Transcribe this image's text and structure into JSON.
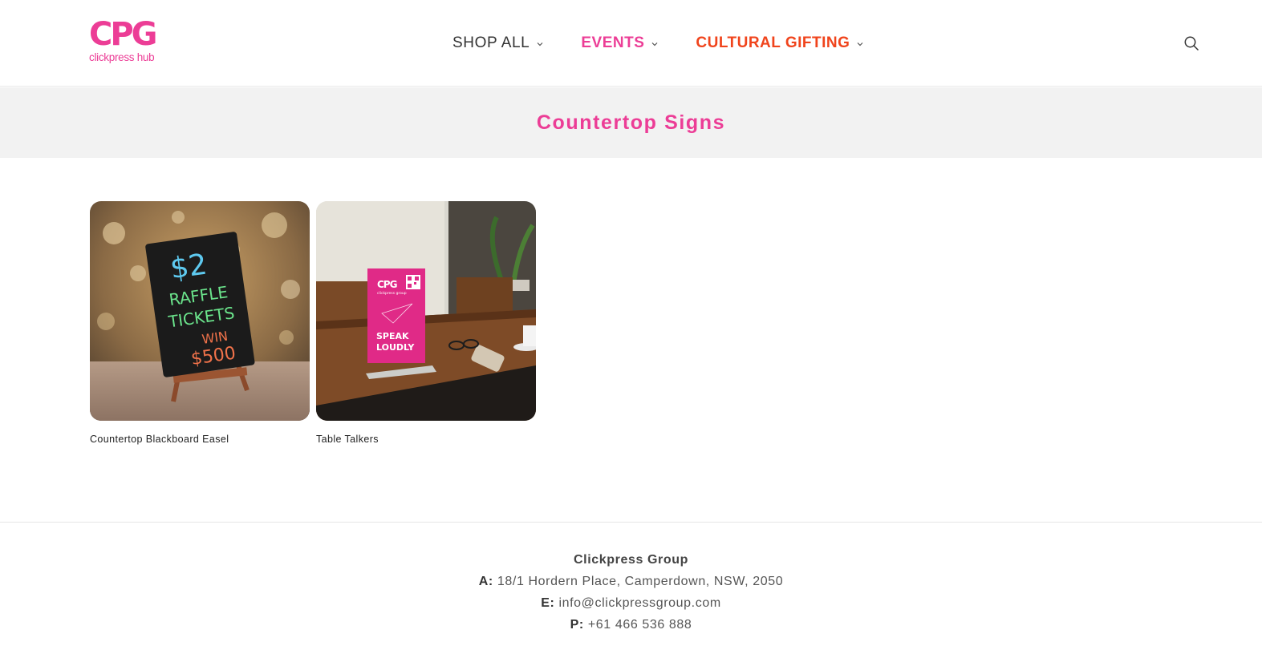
{
  "header": {
    "logo_mark": "CPG",
    "logo_text": "clickpress hub",
    "nav": [
      {
        "label": "SHOP ALL"
      },
      {
        "label": "EVENTS"
      },
      {
        "label": "CULTURAL GIFTING"
      }
    ],
    "search_icon": "search-icon"
  },
  "colors": {
    "brand_pink": "#ec3d96",
    "cultural_orange": "#f0441c",
    "band_gray": "#f2f2f2"
  },
  "page": {
    "title": "Countertop Signs"
  },
  "products": [
    {
      "title": "Countertop Blackboard Easel",
      "image_text": [
        "$2",
        "RAFFLE",
        "TICKETS",
        "WIN",
        "$500"
      ]
    },
    {
      "title": "Table Talkers",
      "image_text": [
        "CPG",
        "clickpress group",
        "SPEAK",
        "LOUDLY"
      ]
    }
  ],
  "footer": {
    "company": "Clickpress Group",
    "address_label": "A:",
    "address": "18/1 Hordern Place, Camperdown, NSW, 2050",
    "email_label": "E:",
    "email": "info@clickpressgroup.com",
    "phone_label": "P:",
    "phone": "+61 466 536 888"
  }
}
